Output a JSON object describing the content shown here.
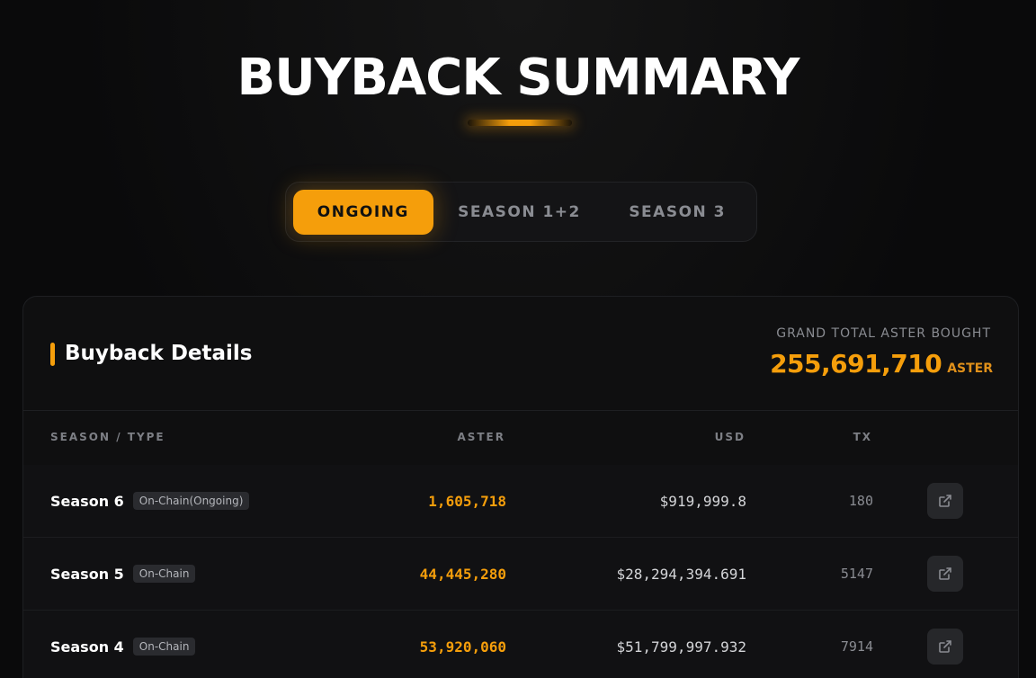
{
  "page": {
    "title": "BUYBACK SUMMARY"
  },
  "tabs": [
    {
      "label": "ONGOING",
      "active": true
    },
    {
      "label": "SEASON 1+2",
      "active": false
    },
    {
      "label": "SEASON 3",
      "active": false
    }
  ],
  "details": {
    "title": "Buyback Details",
    "grand_total_label": "GRAND TOTAL ASTER BOUGHT",
    "grand_total_value": "255,691,710",
    "grand_total_unit": "ASTER"
  },
  "table": {
    "headers": {
      "season": "SEASON / TYPE",
      "aster": "ASTER",
      "usd": "USD",
      "tx": "TX"
    },
    "rows": [
      {
        "season": "Season 6",
        "type": "On-Chain(Ongoing)",
        "aster": "1,605,718",
        "usd": "$919,999.8",
        "tx": "180",
        "link_icon": "external-link-icon"
      },
      {
        "season": "Season 5",
        "type": "On-Chain",
        "aster": "44,445,280",
        "usd": "$28,294,394.691",
        "tx": "5147",
        "link_icon": "external-link-icon"
      },
      {
        "season": "Season 4",
        "type": "On-Chain",
        "aster": "53,920,060",
        "usd": "$51,799,997.932",
        "tx": "7914",
        "link_icon": "external-link-icon"
      }
    ]
  },
  "colors": {
    "accent": "#f59e0b",
    "background": "#0a0a0b",
    "card": "#0f0f10"
  }
}
